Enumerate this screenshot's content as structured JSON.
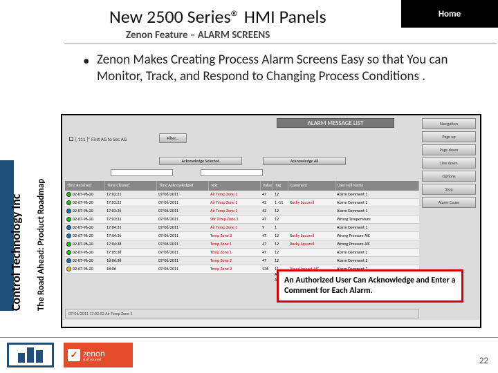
{
  "header": {
    "title": "New 2500 Series® HMI Panels",
    "home": "Home",
    "subtitle": "Zenon Feature – ALARM SCREENS"
  },
  "bullet": "Zenon Makes Creating Process  Alarm Screens Easy so that You can Monitor, Track, and Respond to Changing Process Conditions .",
  "left": {
    "company": "Control Technology Inc",
    "tagline": "The Road Ahead: Product Roadmap"
  },
  "screenshot": {
    "title": "ALARM MESSAGE LIST",
    "buttons": [
      "Navigation",
      "Page up",
      "Page down",
      "Line down",
      "Options",
      "Stop",
      "Alarm Cause"
    ],
    "filter": "[ 111 ]* First AG to Sec AG",
    "filterBtn": "Filter...",
    "ackSel": "Acknowledge Selected",
    "ackAll": "Acknowledge All",
    "headers": [
      "Time Received",
      "Time Cleared",
      "Time Acknowledged",
      "Text",
      "Value",
      "Tag",
      "Comment",
      "User Full Name"
    ],
    "rows": [
      {
        "led": "g",
        "t1": "02-07-96-20",
        "t2": "17:02:21",
        "t3": "07/06/2011",
        "txt": "Air Temp Zone 2",
        "v": "47",
        "tg": "12",
        "c": "",
        "u": "Alarm Comment 1"
      },
      {
        "led": "g",
        "t1": "02-07-96-20",
        "t2": "17:03:22",
        "t3": "07/06/2011",
        "txt": "Air Temp Zone 2",
        "v": "42",
        "tg": "1 -11",
        "c": "Rocky Squarell",
        "u": "Alarm Comment 2"
      },
      {
        "led": "b",
        "t1": "02-07-96-20",
        "t2": "17:03:26",
        "t3": "07/06/2011",
        "txt": "Air Temp Zone 2",
        "v": "42",
        "tg": "12",
        "c": "",
        "u": "Alarm Comment 1"
      },
      {
        "led": "g",
        "t1": "02-07-96-20",
        "t2": "17:03:31",
        "t3": "07/06/2011",
        "txt": "Stir Temp Zone 1",
        "v": "47",
        "tg": "12",
        "c": "",
        "u": "Wrong Temperature"
      },
      {
        "led": "b",
        "t1": "02-07-96-20",
        "t2": "17:04:31",
        "t3": "07/06/2011",
        "txt": "Air Temp Zone 1",
        "v": "9",
        "tg": "1",
        "c": "",
        "u": "Alarm Comment 1"
      },
      {
        "led": "b",
        "t1": "02-07-96-20",
        "t2": "17:04:36",
        "t3": "07/06/2011",
        "txt": "Temp Zone 2",
        "v": "47",
        "tg": "12",
        "c": "Rocky Squarell",
        "u": "Wrong Pressure AlC"
      },
      {
        "led": "g",
        "t1": "02-07-96-20",
        "t2": "17:04:38",
        "t3": "07/06/2011",
        "txt": "Temp Zone 1",
        "v": "47",
        "tg": "12",
        "c": "Rocky Squarell",
        "u": "Wrong Pressure AlC"
      },
      {
        "led": "g",
        "t1": "02-07-96-20",
        "t2": "17:05:38",
        "t3": "07/06/2011",
        "txt": "Temp Zone 1",
        "v": "47",
        "tg": "12",
        "c": "",
        "u": "Alarm Comment 2"
      },
      {
        "led": "b",
        "t1": "02-07-96-20",
        "t2": "18:06:38",
        "t3": "07/06/2011",
        "txt": "Temp Zone 2",
        "v": "47",
        "tg": "12",
        "c": "",
        "u": "Alarm Comment 2"
      },
      {
        "led": "y",
        "t1": "02-07-96-20",
        "t2": "18:06",
        "t3": "07/06/2011",
        "txt": "Temp Zone 2",
        "v": "136",
        "tg": "11 AUK/m AU",
        "c": "Visual Impact AlC",
        "u": "Alarm Comment 2"
      }
    ],
    "status": "07/06/2011 17:02:52  Air Temp Zone 1"
  },
  "callout": "An Authorized User Can Acknowledge and Enter a Comment for Each Alarm.",
  "logos": {
    "zenon": "zenon",
    "zenon_sub": "stuff yourself"
  },
  "page": "22"
}
